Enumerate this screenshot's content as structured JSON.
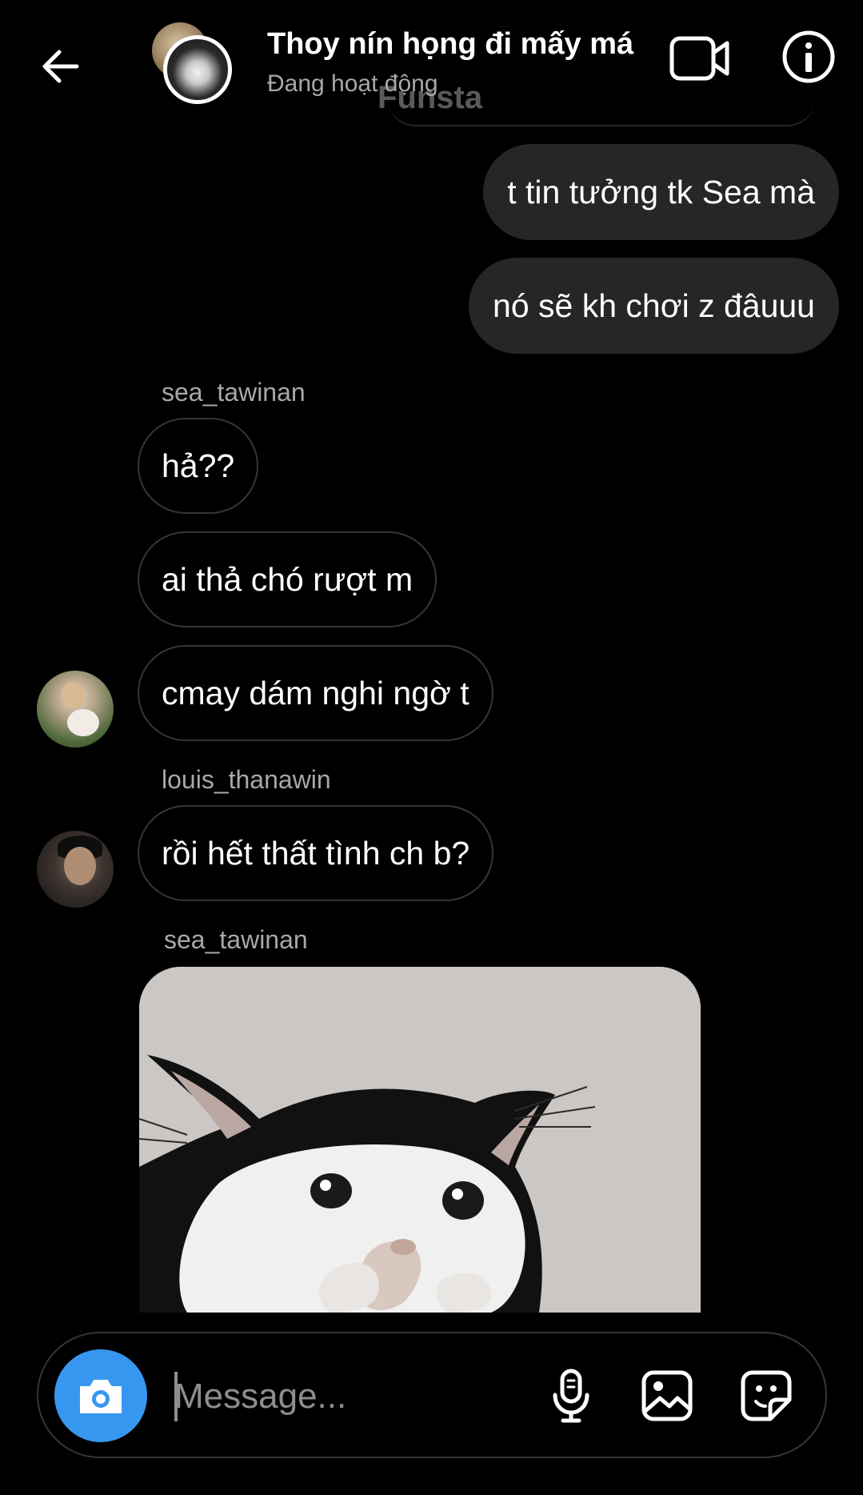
{
  "header": {
    "title": "Thoy nín họng đi mấy má",
    "status": "Đang hoạt động",
    "watermark": "Funsta",
    "icons": {
      "back": "arrow-left-icon",
      "video": "video-camera-icon",
      "info": "info-icon"
    }
  },
  "messages": [
    {
      "from": "me",
      "text": "t tin tưởng tk Sea mà"
    },
    {
      "from": "me",
      "text": "nó sẽ kh chơi z đâuuu"
    },
    {
      "from": "sea_tawinan",
      "sender_label": "sea_tawinan",
      "text": "hả??"
    },
    {
      "from": "sea_tawinan",
      "text": "ai thả chó rượt m"
    },
    {
      "from": "sea_tawinan",
      "text": "cmay dám nghi ngờ t"
    },
    {
      "from": "louis_thanawin",
      "sender_label": "louis_thanawin",
      "text": "rồi hết thất tình ch b?"
    },
    {
      "from": "sea_tawinan",
      "sender_label": "sea_tawinan",
      "type": "image",
      "image_subject": "crying cat meme"
    }
  ],
  "composer": {
    "placeholder": "Message...",
    "icons": {
      "camera": "camera-icon",
      "mic": "microphone-icon",
      "gallery": "image-icon",
      "sticker": "sticker-icon"
    }
  },
  "colors": {
    "accent": "#3797f0",
    "outgoing_bubble": "#262626",
    "background": "#000000",
    "muted_text": "#a8a8a8"
  }
}
